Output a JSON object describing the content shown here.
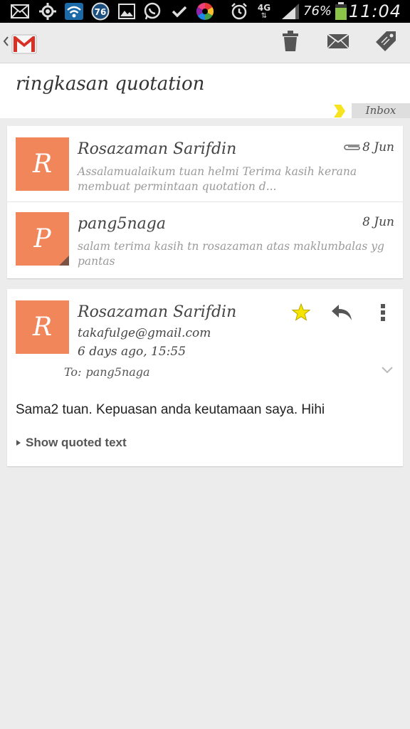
{
  "status_bar": {
    "battery_percent": "76%",
    "time": "11:04",
    "network": "4G",
    "badge_count": "76",
    "icons": [
      "mail-icon",
      "gps-icon",
      "wifi-icon",
      "badge-icon",
      "gallery-icon",
      "whatsapp-icon",
      "check-icon",
      "color-wheel-icon",
      "alarm-icon",
      "network-4g-icon",
      "signal-icon",
      "battery-icon"
    ]
  },
  "action_bar": {
    "icons": [
      "back-icon",
      "gmail-icon",
      "delete-icon",
      "mark-unread-icon",
      "label-icon"
    ]
  },
  "conversation": {
    "subject": "ringkasan quotation",
    "label": "Inbox",
    "label_color": "#f7e31e",
    "avatar_color": "#f0865a",
    "messages_collapsed": [
      {
        "sender": "Rosazaman Sarifdin",
        "initial": "R",
        "date": "8 Jun",
        "has_attachment": true,
        "snippet": "Assalamualaikum tuan helmi Terima kasih kerana membuat permintaan quotation d..."
      },
      {
        "sender": "pang5naga",
        "initial": "P",
        "date": "8 Jun",
        "has_attachment": false,
        "snippet": "salam terima kasih tn rosazaman atas maklumbalas yg pantas"
      }
    ],
    "open_message": {
      "sender": "Rosazaman Sarifdin",
      "initial": "R",
      "email": "takafulge@gmail.com",
      "time": "6 days ago, 15:55",
      "to_label": "To:",
      "to": "pang5naga",
      "starred": true,
      "body": "Sama2 tuan. Kepuasan anda keutamaan saya. Hihi",
      "show_quoted_label": "Show quoted text"
    }
  }
}
